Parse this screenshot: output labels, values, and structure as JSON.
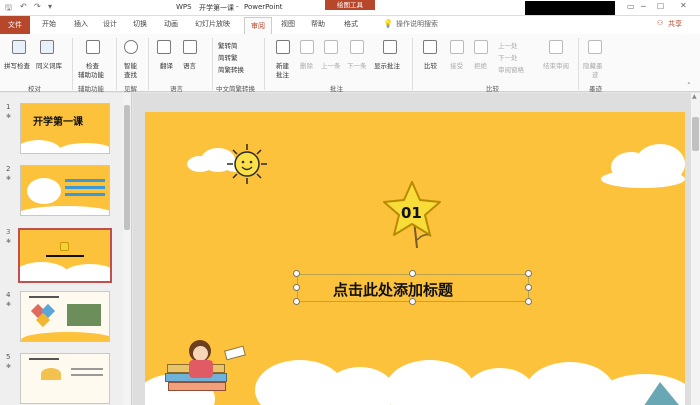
{
  "titlebar": {
    "app": "WPS",
    "doc_title": "开学第一课",
    "app_name": "PowerPoint",
    "context_tab": "绘图工具"
  },
  "tabs": [
    {
      "label": "文件"
    },
    {
      "label": "开始"
    },
    {
      "label": "插入"
    },
    {
      "label": "设计"
    },
    {
      "label": "切换"
    },
    {
      "label": "动画"
    },
    {
      "label": "幻灯片放映"
    },
    {
      "label": "审阅"
    },
    {
      "label": "视图"
    },
    {
      "label": "帮助"
    },
    {
      "label": "格式"
    }
  ],
  "tell_me": "操作说明搜索",
  "share_label": "共享",
  "ribbon": {
    "spelling": "拼写检查",
    "thesaurus": "同义词库",
    "check_acc_1": "检查",
    "check_acc_2": "辅助功能",
    "smart_lookup_1": "智能",
    "smart_lookup_2": "查找",
    "translate": "翻译",
    "language": "语言",
    "to_trad": "繁转简",
    "to_simp": "简转繁",
    "convert": "简繁转换",
    "new_comment_1": "新建",
    "new_comment_2": "批注",
    "delete": "删除",
    "prev": "上一条",
    "next": "下一条",
    "show_comments": "显示批注",
    "compare": "比较",
    "accept": "接受",
    "reject": "拒绝",
    "prev_change": "上一处",
    "next_change": "下一处",
    "reviewing_pane": "审阅窗格",
    "end_review": "结束审阅",
    "ink_1": "隐藏墨",
    "ink_2": "迹",
    "groups": {
      "proofing": "校对",
      "accessibility": "辅助功能",
      "insights": "见解",
      "language": "语言",
      "chinese": "中文简繁转换",
      "comments": "批注",
      "compare": "比较",
      "ink": "墨迹"
    }
  },
  "thumbnails": [
    {
      "num": "1"
    },
    {
      "num": "2"
    },
    {
      "num": "3"
    },
    {
      "num": "4"
    },
    {
      "num": "5"
    }
  ],
  "thumb1_title": "开学第一课",
  "slide": {
    "badge": "01",
    "title": "点击此处添加标题"
  },
  "colors": {
    "accent": "#b7472a",
    "slide_bg": "#fcc23c",
    "selected_thumb": "#c0504d"
  }
}
